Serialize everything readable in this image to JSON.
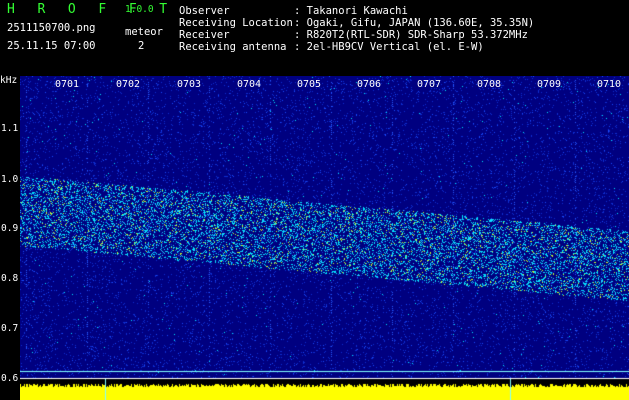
{
  "header": {
    "app_logo": "H R O F F T",
    "version": "1.0.0",
    "filename": "2511150700.png",
    "datetime": "25.11.15 07:00",
    "meteor_label": "meteor",
    "meteor_count": "2",
    "info": [
      {
        "label": "Observer",
        "value": ": Takanori Kawachi"
      },
      {
        "label": "Receiving Location",
        "value": ": Ogaki, Gifu, JAPAN (136.60E, 35.35N)"
      },
      {
        "label": "Receiver",
        "value": ": R820T2(RTL-SDR) SDR-Sharp 53.372MHz"
      },
      {
        "label": "Receiving antenna",
        "value": ": 2el-HB9CV Vertical (el. E-W)"
      }
    ]
  },
  "spectrogram": {
    "y_unit": "kHz",
    "y_ticks": [
      "1.1",
      "1.0",
      "0.9",
      "0.8",
      "0.7",
      "0.6"
    ],
    "x_ticks": [
      "0701",
      "0702",
      "0703",
      "0704",
      "0705",
      "0706",
      "0707",
      "0708",
      "0709",
      "0710"
    ],
    "colors": {
      "background": "#000080",
      "noise": "#1a4cff",
      "signal": "#00e8ff",
      "strong": "#c8ff30",
      "level_bar": "#ffff00",
      "baseline": "#80ffff"
    }
  }
}
